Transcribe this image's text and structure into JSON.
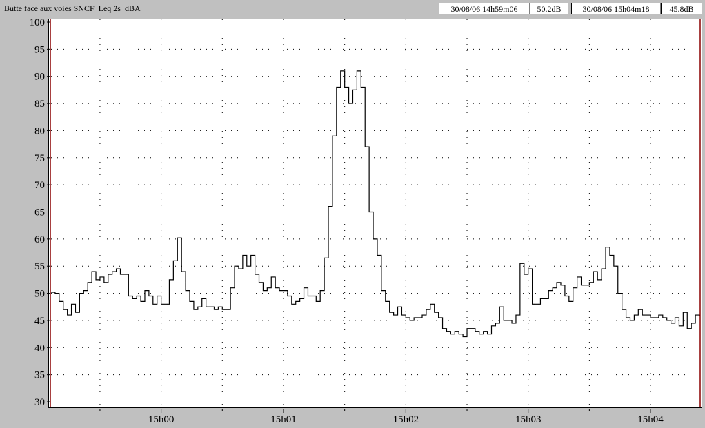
{
  "header": {
    "title": "Butte face aux voies SNCF  Leq 2s  dBA",
    "cursor1_time": "30/08/06 14h59m06",
    "cursor1_value": "50.2dB",
    "cursor2_time": "30/08/06 15h04m18",
    "cursor2_value": "45.8dB"
  },
  "colors": {
    "background": "#c0c0c0",
    "plot_background": "#ffffff",
    "line": "#000000",
    "cursor": "#8b0000"
  },
  "chart_data": {
    "type": "line",
    "step": true,
    "title": "Butte face aux voies SNCF  Leq 2s  dBA",
    "xlabel": "",
    "ylabel": "",
    "ylim": [
      30,
      100
    ],
    "yticks": [
      30,
      35,
      40,
      45,
      50,
      55,
      60,
      65,
      70,
      75,
      80,
      85,
      90,
      95,
      100
    ],
    "x_start": "14h59m06",
    "x_end": "15h04m18",
    "x_step_seconds": 2,
    "xtick_labels": [
      "15h00",
      "15h01",
      "15h02",
      "15h03",
      "15h04"
    ],
    "xtick_seconds": [
      54,
      114,
      174,
      234,
      294
    ],
    "grid": true,
    "cursors": [
      {
        "time": "14h59m06",
        "value": 50.2
      },
      {
        "time": "15h04m18",
        "value": 45.8
      }
    ],
    "values": [
      50.2,
      50,
      48.5,
      47,
      46,
      48,
      46.5,
      50,
      50.5,
      52,
      54,
      52.5,
      53,
      52,
      53.5,
      54,
      54.5,
      53.5,
      53.5,
      49.5,
      49,
      49.5,
      48.5,
      50.5,
      49.5,
      48,
      49.5,
      48,
      48,
      52.5,
      56,
      60.2,
      54,
      50.5,
      48.5,
      47,
      47.5,
      49,
      47.5,
      47.5,
      47,
      47.5,
      47,
      47,
      51,
      55,
      54.5,
      57,
      55,
      57,
      53.5,
      52,
      50.5,
      51,
      53,
      51,
      50.5,
      50.5,
      49.5,
      48,
      48.5,
      49,
      51,
      49.5,
      49.5,
      48.5,
      50.5,
      56.5,
      66,
      79,
      88,
      91,
      88,
      85,
      87.5,
      91,
      88,
      77,
      65,
      60,
      57,
      50.5,
      48.5,
      46.5,
      46,
      47.5,
      46,
      45.5,
      45,
      45.5,
      45.5,
      46,
      47,
      48,
      46.5,
      45.5,
      43.5,
      43,
      42.5,
      43,
      42.5,
      42,
      43.5,
      43.5,
      43,
      42.5,
      43,
      42.5,
      44,
      44.5,
      47.5,
      45,
      45,
      44.5,
      46,
      55.5,
      53.5,
      54.5,
      48,
      48,
      49,
      49,
      50.5,
      51,
      52,
      51.5,
      49.5,
      48.5,
      51,
      53,
      51.5,
      51.5,
      52,
      54,
      52.5,
      54.5,
      58.5,
      57,
      55,
      50,
      47,
      45.5,
      45,
      46,
      47,
      46,
      46,
      45.5,
      45.5,
      46,
      45.5,
      45,
      44.5,
      45.5,
      44,
      46.5,
      43.5,
      44.5,
      46,
      45.8
    ]
  }
}
